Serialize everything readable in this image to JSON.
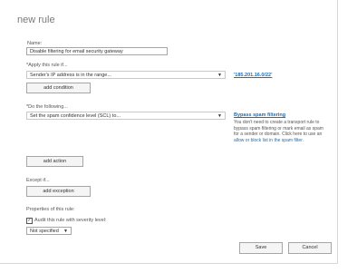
{
  "title": "new rule",
  "name": {
    "label": "Name:",
    "value": "Disable filtering for email security gateway"
  },
  "apply": {
    "label": "*Apply this rule if...",
    "selected": "Sender's IP address is in the range...",
    "value_link": "'185.201.16.0/22'",
    "add_button": "add condition"
  },
  "do": {
    "label": "*Do the following...",
    "selected": "Set the spam confidence level (SCL) to...",
    "value_link": "Bypass spam filtering",
    "help_text": "You don't need to create a transport rule to bypass spam filtering or mark email as spam for a sender or domain. Click here to use an",
    "help_link": "allow or block list in the spam filter.",
    "add_button": "add action"
  },
  "except": {
    "label": "Except if...",
    "add_button": "add exception"
  },
  "properties": {
    "label": "Properties of this rule:",
    "audit_label": "Audit this rule with severity level:",
    "audit_checked": true,
    "severity": "Not specified"
  },
  "footer": {
    "save": "Save",
    "cancel": "Cancel"
  },
  "icons": {
    "dropdown": "chevron-down-icon",
    "check": "checkmark-icon"
  }
}
